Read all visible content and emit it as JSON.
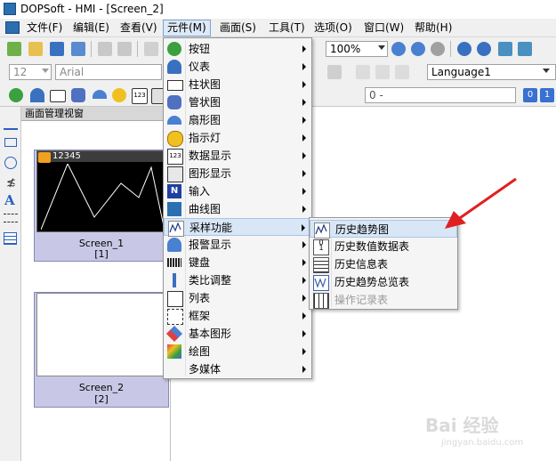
{
  "window": {
    "title": "DOPSoft - HMI - [Screen_2]"
  },
  "menubar": {
    "items": [
      {
        "label": "文件(F)"
      },
      {
        "label": "编辑(E)"
      },
      {
        "label": "查看(V)"
      },
      {
        "label": "元件(M)"
      },
      {
        "label": "画面(S)"
      },
      {
        "label": "工具(T)"
      },
      {
        "label": "选项(O)"
      },
      {
        "label": "窗口(W)"
      },
      {
        "label": "帮助(H)"
      }
    ]
  },
  "toolbar": {
    "zoom": "100%",
    "font_size": "12",
    "font_name": "Arial",
    "language": "Language1",
    "value_field": "0 -",
    "numeric_badge": "0",
    "numeric_badge2": "1"
  },
  "screen_manager": {
    "title": "画面管理视窗",
    "screens": [
      {
        "name": "Screen_1",
        "index": "[1]",
        "preview_text": "12345"
      },
      {
        "name": "Screen_2",
        "index": "[2]"
      }
    ]
  },
  "element_menu": {
    "items": [
      {
        "label": "按钮",
        "icon": "button-icon",
        "submenu": true
      },
      {
        "label": "仪表",
        "icon": "meter-icon",
        "submenu": true
      },
      {
        "label": "柱状图",
        "icon": "bar-graph-icon",
        "submenu": true
      },
      {
        "label": "管状图",
        "icon": "pipe-graph-icon",
        "submenu": true
      },
      {
        "label": "扇形图",
        "icon": "pie-graph-icon",
        "submenu": true
      },
      {
        "label": "指示灯",
        "icon": "indicator-lamp-icon",
        "submenu": true
      },
      {
        "label": "数据显示",
        "icon": "data-display-icon",
        "submenu": true
      },
      {
        "label": "图形显示",
        "icon": "graphic-display-icon",
        "submenu": true
      },
      {
        "label": "输入",
        "icon": "input-icon",
        "submenu": true
      },
      {
        "label": "曲线图",
        "icon": "curve-graph-icon",
        "submenu": true
      },
      {
        "label": "采样功能",
        "icon": "sampling-icon",
        "submenu": true
      },
      {
        "label": "报警显示",
        "icon": "alarm-icon",
        "submenu": true
      },
      {
        "label": "键盘",
        "icon": "keyboard-icon",
        "submenu": true
      },
      {
        "label": "类比调整",
        "icon": "analog-adjust-icon",
        "submenu": true
      },
      {
        "label": "列表",
        "icon": "list-icon",
        "submenu": true
      },
      {
        "label": "框架",
        "icon": "frame-icon",
        "submenu": true
      },
      {
        "label": "基本图形",
        "icon": "basic-shape-icon",
        "submenu": true
      },
      {
        "label": "绘图",
        "icon": "drawing-icon",
        "submenu": true
      },
      {
        "label": "多媒体",
        "icon": "multimedia-icon",
        "submenu": true
      }
    ]
  },
  "sampling_submenu": {
    "items": [
      {
        "label": "历史趋势图",
        "icon": "history-trend-icon",
        "enabled": true
      },
      {
        "label": "历史数值数据表",
        "icon": "history-data-table-icon",
        "enabled": true
      },
      {
        "label": "历史信息表",
        "icon": "history-info-icon",
        "enabled": true
      },
      {
        "label": "历史趋势总览表",
        "icon": "history-trend-overview-icon",
        "enabled": true
      },
      {
        "label": "操作记录表",
        "icon": "operation-log-icon",
        "enabled": false
      }
    ]
  },
  "watermark": {
    "text": "Bai 经验",
    "sub": "jingyan.baidu.com"
  },
  "colors": {
    "annotation_arrow": "#e02020",
    "menu_highlight": "#d8e6f6"
  }
}
